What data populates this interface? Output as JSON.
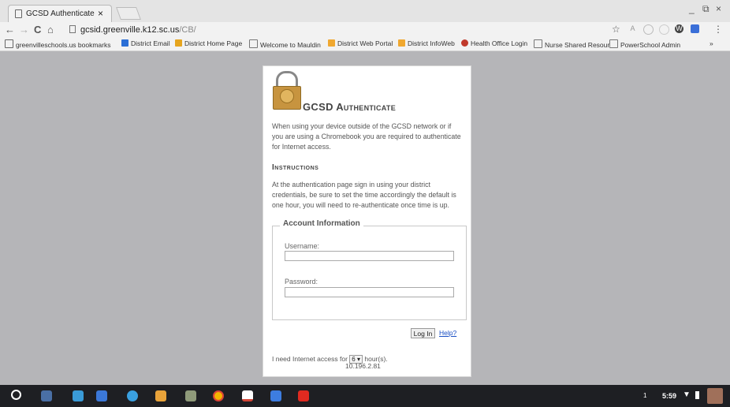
{
  "tab": {
    "title": "GCSD Authenticate",
    "close": "×"
  },
  "window": {
    "min": "_",
    "restore": "⧉",
    "close": "×"
  },
  "nav": {
    "back": "←",
    "forward": "→",
    "reload": "C",
    "home": "⌂"
  },
  "omnibox": {
    "host": "gcsid.greenville.k12.sc.us",
    "path": "/CB/",
    "star": "☆"
  },
  "bookmarks": [
    {
      "label": "greenvilleschools.us bookmarks",
      "color": "#666"
    },
    {
      "label": "District Email",
      "color": "#2b6fd6"
    },
    {
      "label": "District Home Page",
      "color": "#e6a51e"
    },
    {
      "label": "Welcome to Mauldin",
      "color": "#fff"
    },
    {
      "label": "District Web Portal",
      "color": "#f0a830"
    },
    {
      "label": "District InfoWeb",
      "color": "#f0a830"
    },
    {
      "label": "Health Office Login",
      "color": "#c0392b"
    },
    {
      "label": "Nurse Shared Resour",
      "color": "#fff"
    },
    {
      "label": "PowerSchool Admin",
      "color": "#fff"
    }
  ],
  "bookmarks_more": "»",
  "page": {
    "title": "GCSD Authenticate",
    "intro": "When using your device outside of the GCSD network or if you are using a Chromebook you are required to authenticate for Internet access.",
    "instructions_heading": "Instructions",
    "instructions": "At the authentication page sign in using your district credentials, be sure to set the time accordingly the default is one hour, you will need to re-authenticate once time is up.",
    "legend": "Account Information",
    "username_label": "Username:",
    "username_value": "",
    "password_label": "Password:",
    "password_value": "",
    "login": "Log In",
    "help": "Help?",
    "access_prefix": "I need Internet access for",
    "hours_value": "6 ▾",
    "access_suffix": "hour(s).",
    "ip": "10.196.2.81"
  },
  "shelf": {
    "notification_count": "1",
    "time": "5:59"
  }
}
